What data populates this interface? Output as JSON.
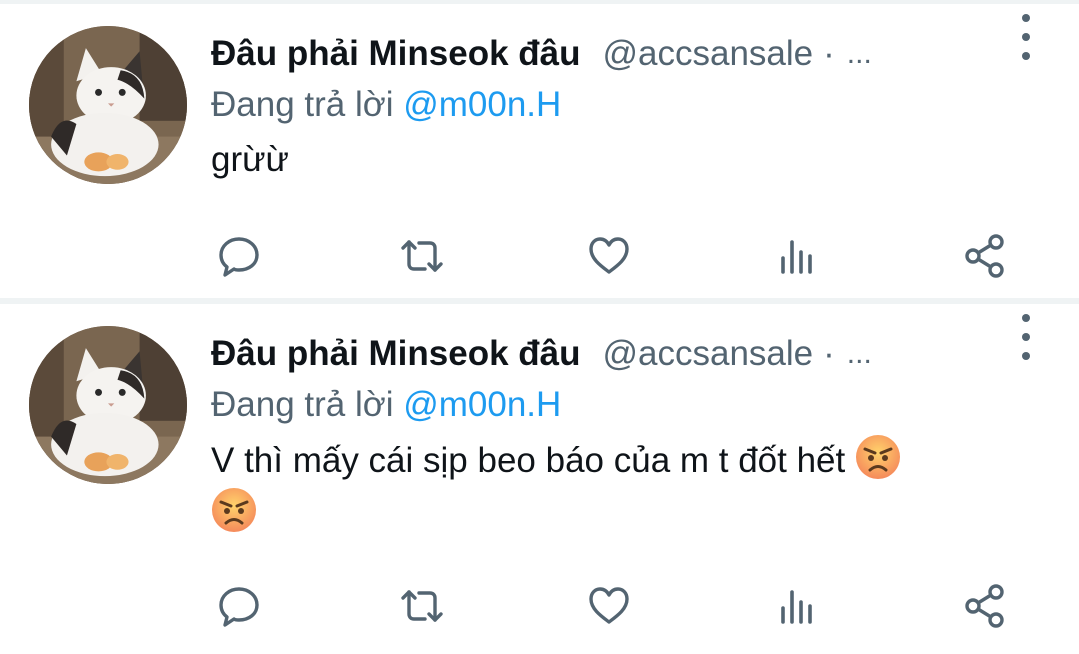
{
  "tweets": [
    {
      "display_name": "Đâu phải Minseok đâu",
      "handle": "@accsansale",
      "separator": "·",
      "truncation": "...",
      "reply_prefix": "Đang trả lời ",
      "reply_mention": "@m00n.H",
      "text": "grừừ",
      "emojis": []
    },
    {
      "display_name": "Đâu phải Minseok đâu",
      "handle": "@accsansale",
      "separator": "·",
      "truncation": "...",
      "reply_prefix": "Đang trả lời ",
      "reply_mention": "@m00n.H",
      "text": "V thì mấy cái sịp beo báo của m t đốt hết",
      "emojis": [
        "angry-face",
        "angry-face"
      ]
    }
  ],
  "colors": {
    "text_primary": "#0f1419",
    "text_secondary": "#536471",
    "accent": "#1d9bf0",
    "divider": "#eff3f4"
  },
  "icons": {
    "reply": "reply-icon",
    "retweet": "retweet-icon",
    "like": "like-icon",
    "views": "views-icon",
    "share": "share-icon",
    "more": "more-vertical-icon"
  }
}
